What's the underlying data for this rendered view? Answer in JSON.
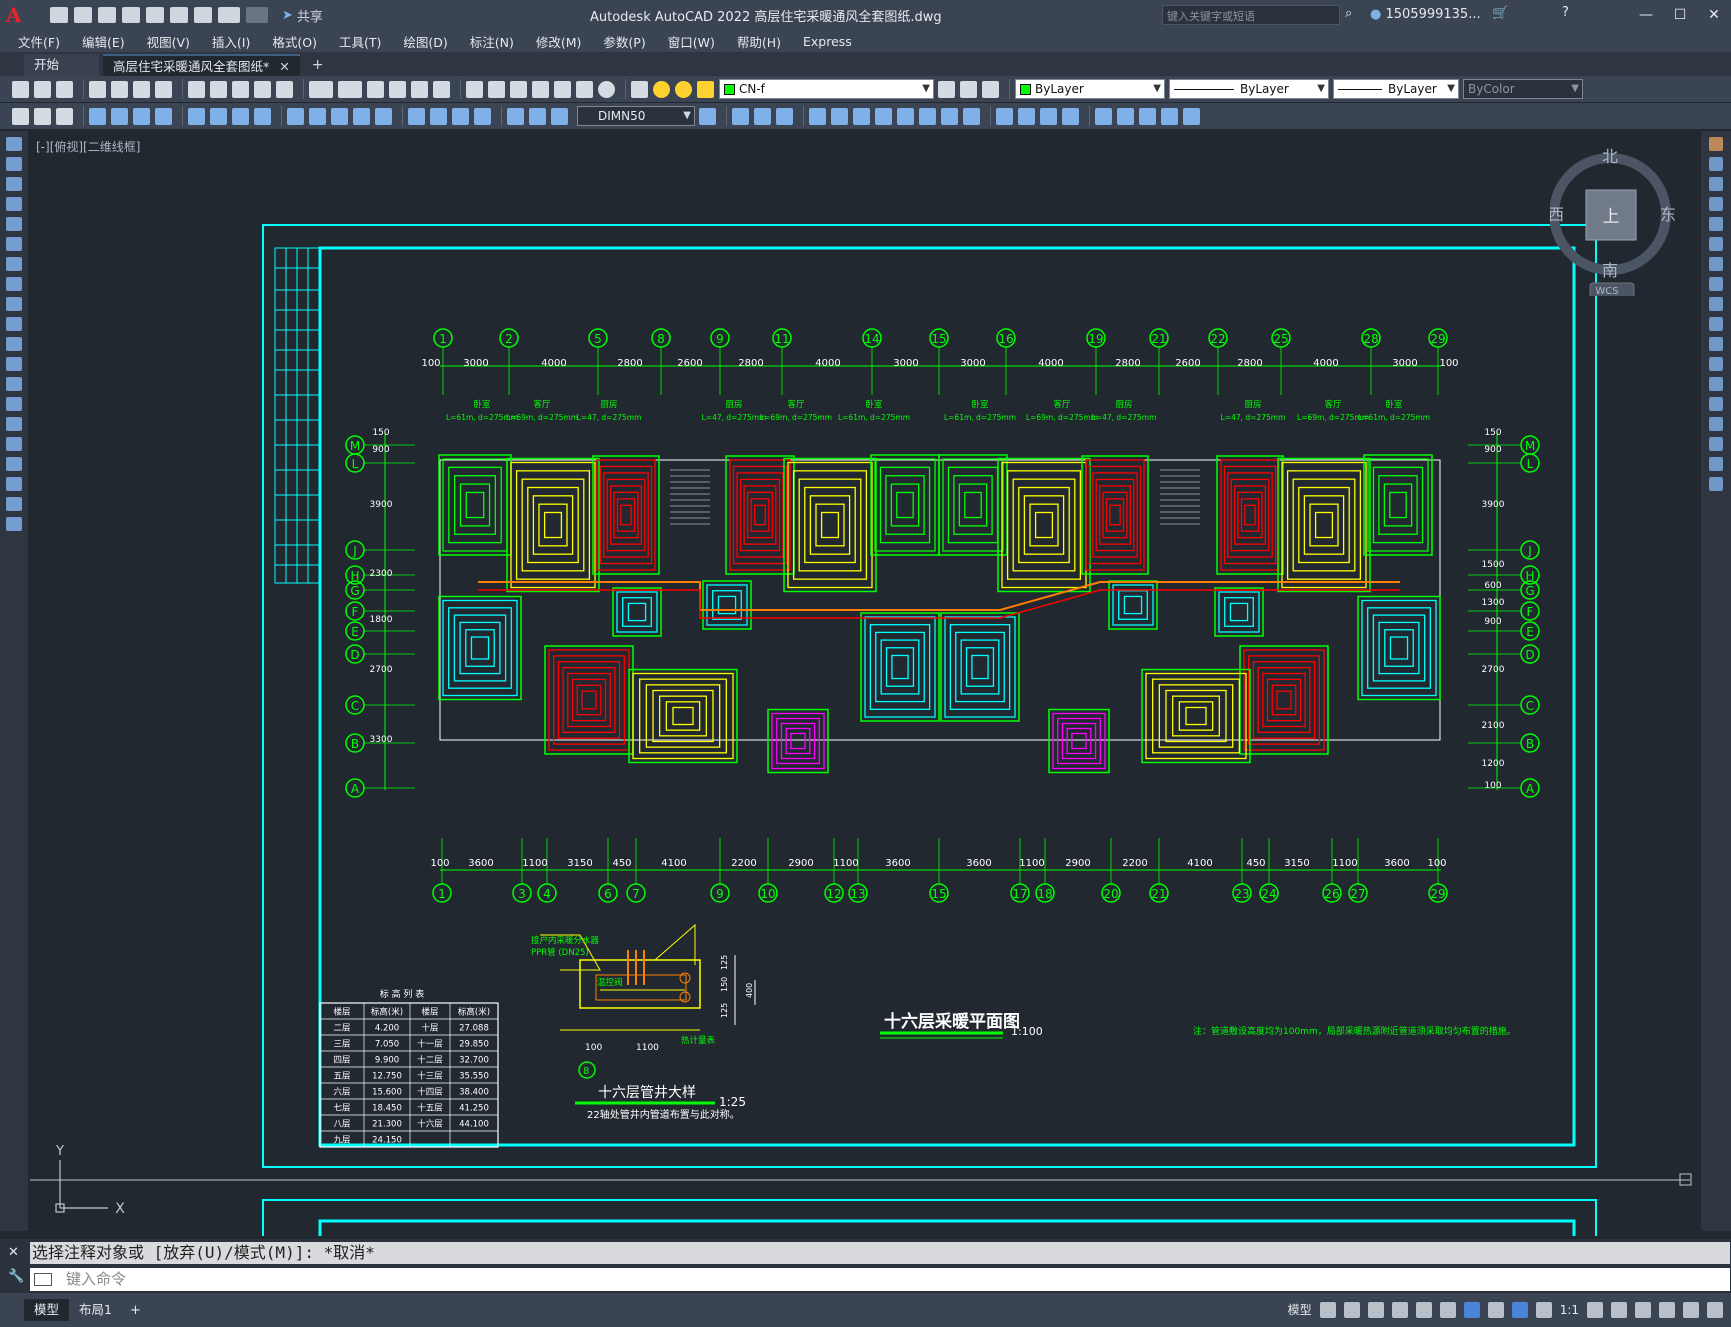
{
  "app": {
    "title": "Autodesk AutoCAD 2022    高层住宅采暖通风全套图纸.dwg",
    "share_label": "共享",
    "search_placeholder": "键入关键字或短语",
    "user": "1505999135...",
    "logo": "A"
  },
  "menu": [
    "文件(F)",
    "编辑(E)",
    "视图(V)",
    "插入(I)",
    "格式(O)",
    "工具(T)",
    "绘图(D)",
    "标注(N)",
    "修改(M)",
    "参数(P)",
    "窗口(W)",
    "帮助(H)",
    "Express"
  ],
  "tabs": [
    {
      "label": "开始"
    },
    {
      "label": "高层住宅采暖通风全套图纸*"
    }
  ],
  "toolbar": {
    "layer": "CN-f",
    "color": "ByLayer",
    "linetype": "ByLayer",
    "lineweight": "ByLayer",
    "plotstyle": "ByColor",
    "dimstyle": "DIMN50"
  },
  "viewport_label": "[-][俯视][二维线框]",
  "viewcube": {
    "north": "北",
    "south": "南",
    "east": "东",
    "west": "西",
    "face": "上",
    "wcs": "WCS"
  },
  "drawing": {
    "plan_title": "十六层采暖平面图",
    "plan_scale": "1:100",
    "detail_title": "十六层管井大样",
    "detail_scale": "1:25",
    "detail_note": "22轴处管井内管道布置与此对称。",
    "note": "注：管道敷设高度均为100mm，局部采暖热源附近管道须采取均匀布置的措施。",
    "top_axes": [
      "1",
      "2",
      "5",
      "8",
      "9",
      "11",
      "14",
      "15",
      "16",
      "19",
      "21",
      "22",
      "25",
      "28",
      "29"
    ],
    "top_dims": [
      "100",
      "3000",
      "4000",
      "2800",
      "2600",
      "2800",
      "4000",
      "3000",
      "3000",
      "4000",
      "2800",
      "2600",
      "2800",
      "4000",
      "3000",
      "100"
    ],
    "bottom_axes": [
      "1",
      "3",
      "4",
      "6",
      "7",
      "9",
      "10",
      "12",
      "13",
      "15",
      "17",
      "18",
      "20",
      "21",
      "23",
      "24",
      "26",
      "27",
      "29"
    ],
    "bottom_dims": [
      "100",
      "3600",
      "1100",
      "3150",
      "450",
      "4100",
      "2200",
      "2900",
      "1100",
      "3600",
      "3600",
      "1100",
      "2900",
      "2200",
      "4100",
      "450",
      "3150",
      "1100",
      "3600",
      "100"
    ],
    "left_axes": [
      "M",
      "L",
      "J",
      "H",
      "G",
      "F",
      "E",
      "D",
      "C",
      "B",
      "A"
    ],
    "left_dims": [
      "150",
      "900",
      "3900",
      "2300",
      "1800",
      "2700",
      "3300"
    ],
    "right_dims": [
      "150",
      "900",
      "3900",
      "1500",
      "600",
      "1300",
      "900",
      "2700",
      "2100",
      "1200",
      "100"
    ],
    "room_labels": [
      {
        "name": "卧室",
        "spec": "L=61m, d=275mm"
      },
      {
        "name": "客厅",
        "spec": "L=69m, d=275mm"
      },
      {
        "name": "厨房",
        "spec": "L=47, d=275mm"
      },
      {
        "name": "厨房",
        "spec": "L=47, d=275mm"
      },
      {
        "name": "客厅",
        "spec": "L=69m, d=275mm"
      },
      {
        "name": "卧室",
        "spec": "L=61m, d=275mm"
      },
      {
        "name": "卧室",
        "spec": "L=61m, d=275mm"
      },
      {
        "name": "客厅",
        "spec": "L=69m, d=275mm"
      },
      {
        "name": "厨房",
        "spec": "L=47, d=275mm"
      },
      {
        "name": "厨房",
        "spec": "L=47, d=275mm"
      },
      {
        "name": "客厅",
        "spec": "L=69m, d=275mm"
      },
      {
        "name": "卧室",
        "spec": "L=61m, d=275mm"
      }
    ],
    "elevation_table": {
      "title": "标 高 列 表",
      "headers": [
        "楼层",
        "标高(米)",
        "楼层",
        "标高(米)"
      ],
      "rows": [
        [
          "二层",
          "4.200",
          "十层",
          "27.088"
        ],
        [
          "三层",
          "7.050",
          "十一层",
          "29.850"
        ],
        [
          "四层",
          "9.900",
          "十二层",
          "32.700"
        ],
        [
          "五层",
          "12.750",
          "十三层",
          "35.550"
        ],
        [
          "六层",
          "15.600",
          "十四层",
          "38.400"
        ],
        [
          "七层",
          "18.450",
          "十五层",
          "41.250"
        ],
        [
          "八层",
          "21.300",
          "十六层",
          "44.100"
        ],
        [
          "九层",
          "24.150",
          "",
          ""
        ]
      ]
    },
    "detail_labels": [
      "接户内采暖分水器",
      "PPR管 (DN25)",
      "温控阀",
      "热计量表",
      "100",
      "1100",
      "8",
      "125",
      "150",
      "125",
      "400"
    ]
  },
  "command": {
    "history": "选择注释对象或 [放弃(U)/模式(M)]: *取消*",
    "placeholder": "键入命令"
  },
  "status": {
    "layout_tabs": [
      "模型",
      "布局1"
    ],
    "model_label": "模型",
    "scale": "1:1"
  },
  "colors": {
    "background": "#212830",
    "frame": "#00ffff",
    "green": "#00ff00",
    "yellow": "#ffff00",
    "red": "#ff0000",
    "cyan": "#00ffff",
    "magenta": "#ff00ff"
  }
}
